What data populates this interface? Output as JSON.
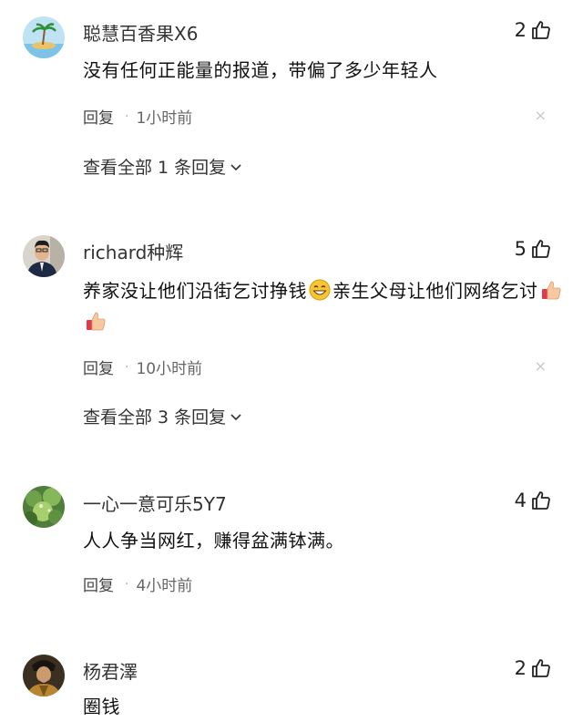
{
  "comments": [
    {
      "username": "聪慧百香果X6",
      "likes": "2",
      "text": "没有任何正能量的报道，带偏了多少年轻人",
      "reply_label": "回复",
      "time": "1小时前",
      "view_replies": "查看全部 1 条回复",
      "avatar_icon": "beach-island-avatar"
    },
    {
      "username": "richard种辉",
      "likes": "5",
      "text_a": "养家没让他们沿街乞讨挣钱",
      "text_b": "亲生父母让他们网络乞讨",
      "emojis": [
        "grin-emoji",
        "thumbs-up-emoji",
        "thumbs-up-emoji"
      ],
      "reply_label": "回复",
      "time": "10小时前",
      "view_replies": "查看全部 3 条回复",
      "avatar_icon": "man-portrait-avatar"
    },
    {
      "username": "一心一意可乐5Y7",
      "likes": "4",
      "text": "人人争当网红，赚得盆满钵满。",
      "reply_label": "回复",
      "time": "4小时前",
      "avatar_icon": "green-plant-avatar"
    },
    {
      "username": "杨君澤",
      "likes": "2",
      "text": "圈钱",
      "avatar_icon": "historical-figure-avatar"
    }
  ],
  "close_glyph": "×",
  "colors": {
    "muted": "#aaaaaa",
    "text": "#111111",
    "close": "#c8c8c8"
  }
}
